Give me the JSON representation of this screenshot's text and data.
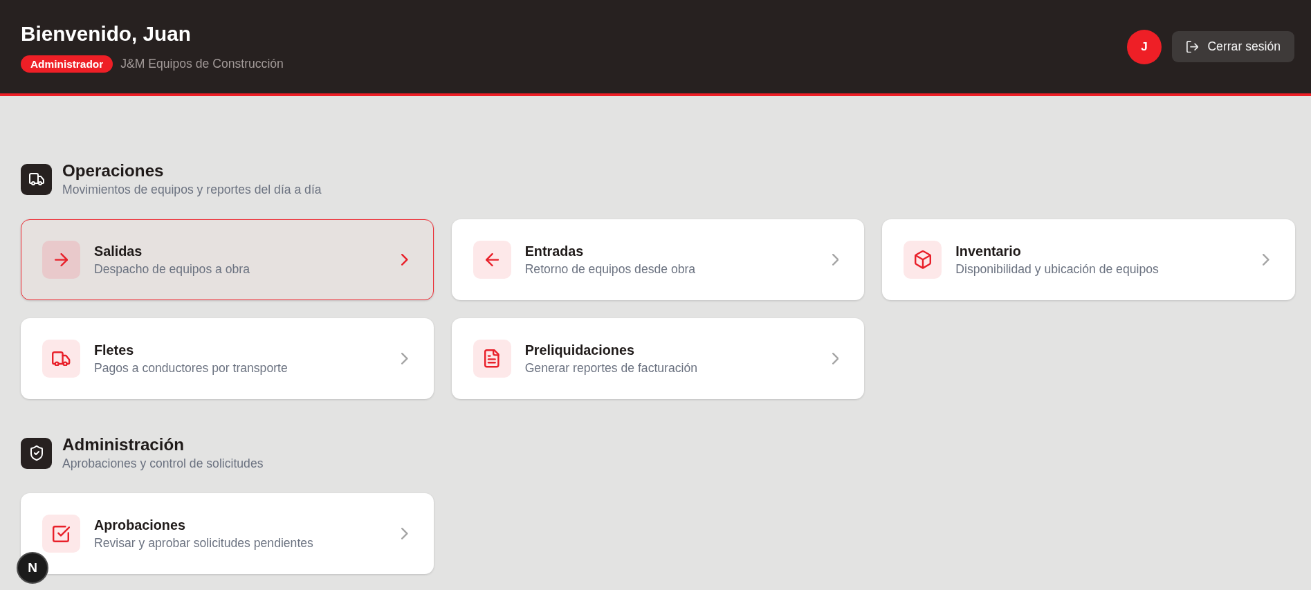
{
  "header": {
    "title": "Bienvenido, Juan",
    "role_badge": "Administrador",
    "company": "J&M Equipos de Construcción",
    "avatar": {
      "initial": "J"
    },
    "logout_button": {
      "label": "Cerrar sesión"
    }
  },
  "sections": [
    {
      "kind": "operations",
      "title": "Operaciones",
      "subtitle": "Movimientos de equipos y reportes del día a día",
      "cards": [
        {
          "kind": "dispatch",
          "title": "Salidas",
          "description": "Despacho de equipos a obra",
          "selected": true
        },
        {
          "kind": "return",
          "title": "Entradas",
          "description": "Retorno de equipos desde obra",
          "selected": false
        },
        {
          "kind": "inventory",
          "title": "Inventario",
          "description": "Disponibilidad y ubicación de equipos",
          "selected": false
        },
        {
          "kind": "freight",
          "title": "Fletes",
          "description": "Pagos a conductores por transporte",
          "selected": false
        },
        {
          "kind": "billing",
          "title": "Preliquidaciones",
          "description": "Generar reportes de facturación",
          "selected": false
        }
      ]
    },
    {
      "kind": "admin",
      "title": "Administración",
      "subtitle": "Aprobaciones y control de solicitudes",
      "cards": [
        {
          "kind": "approval",
          "title": "Aprobaciones",
          "description": "Revisar y aprobar solicitudes pendientes",
          "selected": false
        }
      ]
    }
  ],
  "dev_indicator": {
    "label": "N"
  }
}
